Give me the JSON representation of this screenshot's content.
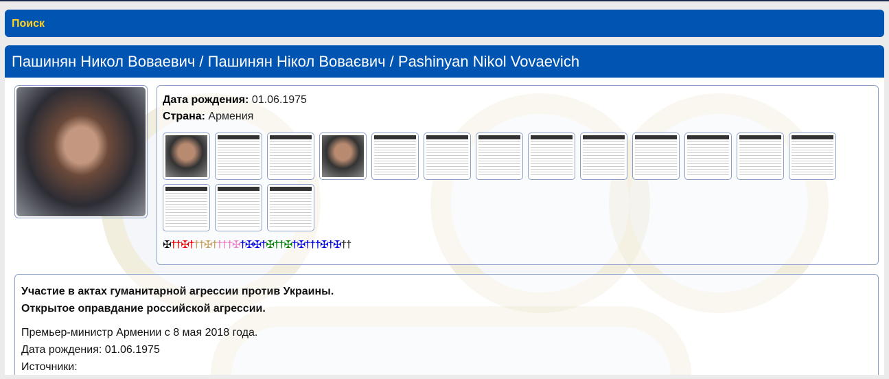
{
  "search": {
    "label": "Поиск"
  },
  "person": {
    "title": "Пашинян Никол Воваевич / Пашинян Нікол Воваєвич / Pashinyan Nikol Vovaevich",
    "birth_label": "Дата рождения:",
    "birth_value": "01.06.1975",
    "country_label": "Страна:",
    "country_value": "Армения"
  },
  "thumbnails": 16,
  "crosses": [
    [
      "✠",
      "#000"
    ],
    [
      "†",
      "#e00"
    ],
    [
      "†",
      "#e00"
    ],
    [
      "✠",
      "#e00"
    ],
    [
      "†",
      "#e00"
    ],
    [
      "†",
      "#c8a060"
    ],
    [
      "†",
      "#c8a060"
    ],
    [
      "✠",
      "#c8a060"
    ],
    [
      "†",
      "#c8a060"
    ],
    [
      "†",
      "#f080c8"
    ],
    [
      "†",
      "#f080c8"
    ],
    [
      "†",
      "#f080c8"
    ],
    [
      "✠",
      "#f080c8"
    ],
    [
      "†",
      "#0000e0"
    ],
    [
      "✠",
      "#0000e0"
    ],
    [
      "✠",
      "#0000e0"
    ],
    [
      "†",
      "#0000e0"
    ],
    [
      "✠",
      "#008000"
    ],
    [
      "†",
      "#008000"
    ],
    [
      "†",
      "#008000"
    ],
    [
      "✠",
      "#008000"
    ],
    [
      "†",
      "#0000e0"
    ],
    [
      "✠",
      "#0000e0"
    ],
    [
      "†",
      "#0000e0"
    ],
    [
      "†",
      "#0000e0"
    ],
    [
      "†",
      "#0000e0"
    ],
    [
      "✠",
      "#0000e0"
    ],
    [
      "†",
      "#0000e0"
    ],
    [
      "✠",
      "#0000e0"
    ],
    [
      "†",
      "#333"
    ],
    [
      "†",
      "#333"
    ]
  ],
  "description": {
    "heading1": "Участие в актах гуманитарной агрессии против Украины.",
    "heading2": "Открытое оправдание российской агрессии.",
    "line1": "Премьер-министр Армении с 8 мая 2018 года.",
    "line2": "Дата рождения: 01.06.1975",
    "line3": "Источники:"
  }
}
